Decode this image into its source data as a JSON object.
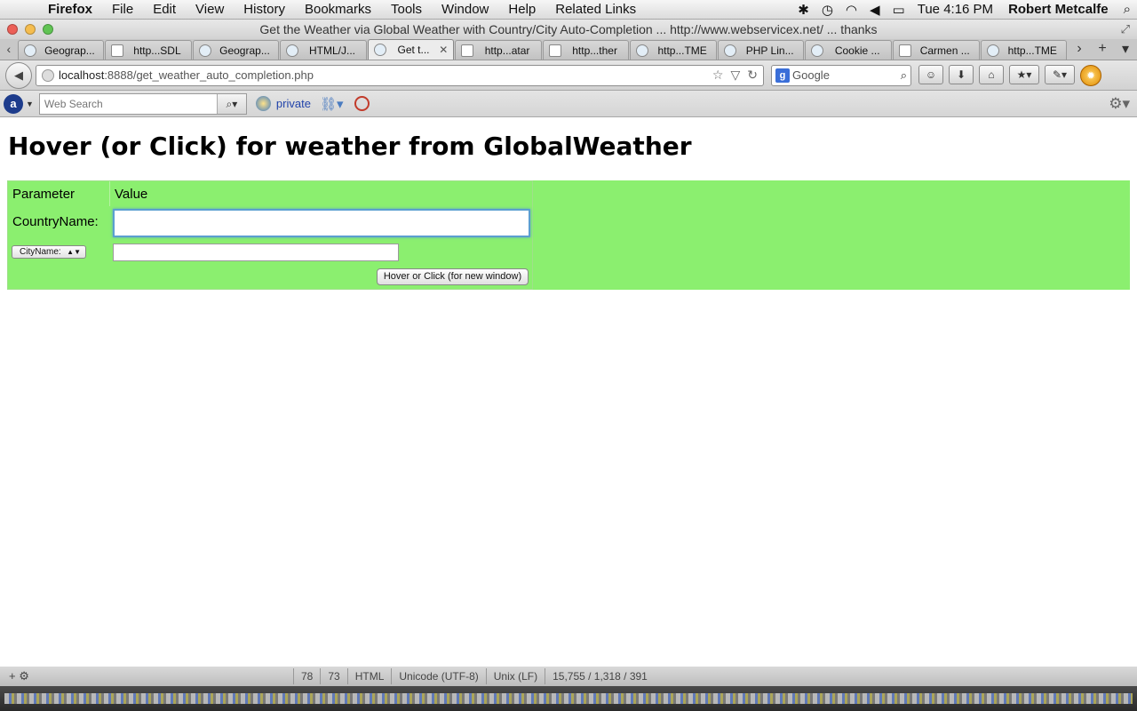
{
  "menubar": {
    "app": "Firefox",
    "items": [
      "File",
      "Edit",
      "View",
      "History",
      "Bookmarks",
      "Tools",
      "Window",
      "Help",
      "Related Links"
    ],
    "clock": "Tue 4:16 PM",
    "user": "Robert Metcalfe"
  },
  "window": {
    "title": "Get the Weather via Global Weather with Country/City Auto-Completion ... http://www.webservicex.net/ ... thanks"
  },
  "tabs": [
    {
      "label": "Geograp..."
    },
    {
      "label": "http...SDL"
    },
    {
      "label": "Geograp..."
    },
    {
      "label": "HTML/J..."
    },
    {
      "label": "Get t..."
    },
    {
      "label": "http...atar"
    },
    {
      "label": "http...ther"
    },
    {
      "label": "http...TME"
    },
    {
      "label": "PHP Lin..."
    },
    {
      "label": "Cookie ..."
    },
    {
      "label": "Carmen ..."
    },
    {
      "label": "http...TME"
    }
  ],
  "navbar": {
    "url_host": "localhost",
    "url_path": ":8888/get_weather_auto_completion.php",
    "search_engine": "Google"
  },
  "addonbar": {
    "websearch_placeholder": "Web Search",
    "private_label": "private"
  },
  "page": {
    "heading": "Hover (or Click) for weather from GlobalWeather",
    "table": {
      "header_param": "Parameter",
      "header_value": "Value",
      "country_label": "CountryName:",
      "country_value": "",
      "city_select": "CityName:",
      "city_value": "",
      "button_label": "Hover or Click (for new window)"
    },
    "colors": {
      "green": "#8bef6f"
    }
  },
  "statusbar": {
    "line": "78",
    "col": "73",
    "lang": "HTML",
    "encoding": "Unicode (UTF-8)",
    "lineend": "Unix (LF)",
    "stats": "15,755 / 1,318 / 391"
  }
}
